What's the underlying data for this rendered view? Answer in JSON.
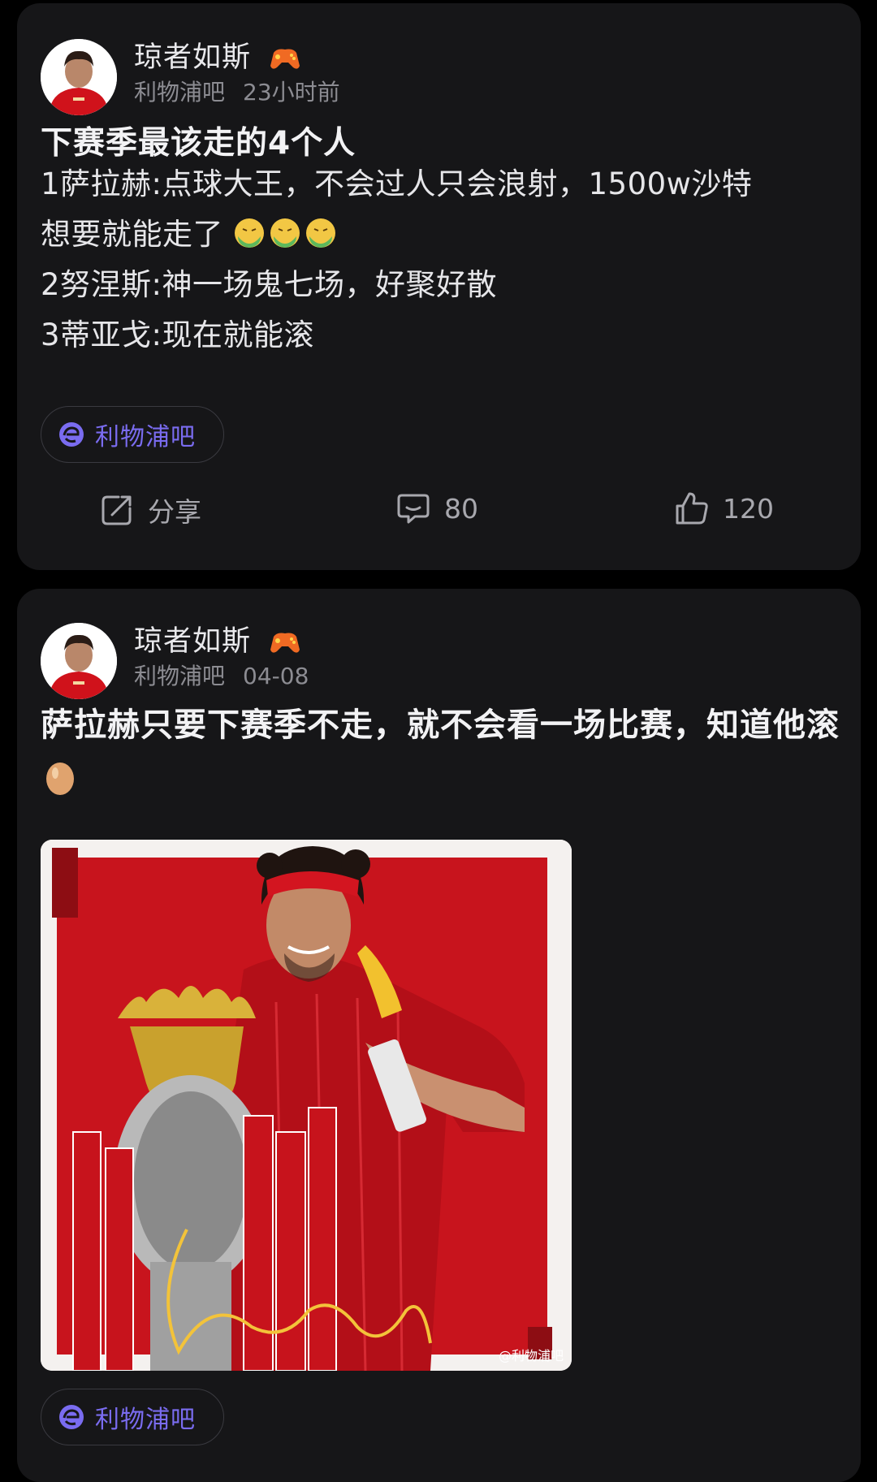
{
  "posts": [
    {
      "author": "琼者如斯",
      "forum": "利物浦吧",
      "time": "23小时前",
      "title": "下赛季最该走的4个人",
      "lines": [
        "1萨拉赫:点球大王，不会过人只会浪射，1500w沙特",
        "想要就能走了",
        "2努涅斯:神一场鬼七场，好聚好散",
        "3蒂亚戈:现在就能滚"
      ],
      "tag": "利物浦吧",
      "actions": {
        "share_label": "分享",
        "comment_count": "80",
        "like_count": "120"
      }
    },
    {
      "author": "琼者如斯",
      "forum": "利物浦吧",
      "time": "04-08",
      "title": "萨拉赫只要下赛季不走，就不会看一场比赛，知道他滚",
      "image_watermark": "@利物浦吧",
      "tag": "利物浦吧"
    }
  ],
  "icons": {
    "badge": "game-controller-icon",
    "vomit_emoji": "nauseated-face-icon",
    "egg_emoji": "egg-icon",
    "tag": "forum-logo-icon",
    "share": "share-icon",
    "comment": "comment-icon",
    "like": "thumbs-up-icon"
  },
  "colors": {
    "background": "#000000",
    "card": "#161618",
    "accent": "#7a6cf0",
    "muted": "#8c8c92"
  }
}
